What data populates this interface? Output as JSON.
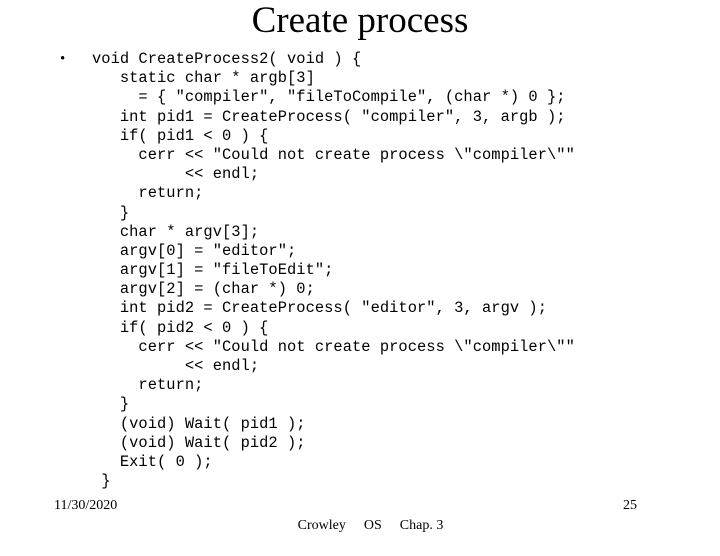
{
  "slide": {
    "title": "Create process",
    "bullet_glyph": "•",
    "code_lines": [
      {
        "bullet": true,
        "text": "void CreateProcess2( void ) {"
      },
      {
        "bullet": false,
        "text": "   static char * argb[3]"
      },
      {
        "bullet": false,
        "text": "     = { \"compiler\", \"fileToCompile\", (char *) 0 };"
      },
      {
        "bullet": false,
        "text": "   int pid1 = CreateProcess( \"compiler\", 3, argb );"
      },
      {
        "bullet": false,
        "text": "   if( pid1 < 0 ) {"
      },
      {
        "bullet": false,
        "text": "     cerr << \"Could not create process \\\"compiler\\\"\""
      },
      {
        "bullet": false,
        "text": "          << endl;"
      },
      {
        "bullet": false,
        "text": "     return;"
      },
      {
        "bullet": false,
        "text": "   }"
      },
      {
        "bullet": false,
        "text": "   char * argv[3];"
      },
      {
        "bullet": false,
        "text": "   argv[0] = \"editor\";"
      },
      {
        "bullet": false,
        "text": "   argv[1] = \"fileToEdit\";"
      },
      {
        "bullet": false,
        "text": "   argv[2] = (char *) 0;"
      },
      {
        "bullet": false,
        "text": "   int pid2 = CreateProcess( \"editor\", 3, argv );"
      },
      {
        "bullet": false,
        "text": "   if( pid2 < 0 ) {"
      },
      {
        "bullet": false,
        "text": "     cerr << \"Could not create process \\\"compiler\\\"\""
      },
      {
        "bullet": false,
        "text": "          << endl;"
      },
      {
        "bullet": false,
        "text": "     return;"
      },
      {
        "bullet": false,
        "text": "   }"
      },
      {
        "bullet": false,
        "text": "   (void) Wait( pid1 );"
      },
      {
        "bullet": false,
        "text": "   (void) Wait( pid2 );"
      },
      {
        "bullet": false,
        "text": "   Exit( 0 );"
      },
      {
        "bullet": false,
        "text": " }"
      }
    ]
  },
  "footer": {
    "date": "11/30/2020",
    "author": "Crowley",
    "course": "OS",
    "chapter": "Chap. 3",
    "page_number": "25"
  },
  "colors": {
    "background": "#ffffff",
    "text": "#000000"
  }
}
